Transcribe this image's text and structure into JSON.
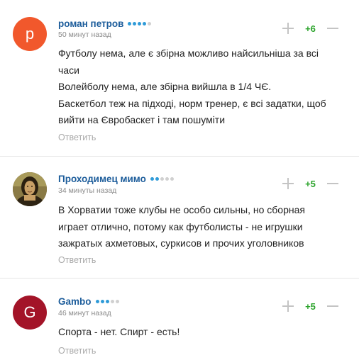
{
  "comments": [
    {
      "avatar_letter": "р",
      "avatar_color": "#f1582c",
      "author": "роман петров",
      "rank_dots": [
        "#2f9bd8",
        "#2f9bd8",
        "#2f9bd8",
        "#2f9bd8",
        "#d0d0d0"
      ],
      "time": "50 минут назад",
      "score": "+6",
      "lines": [
        "Футболу нема, але є збірна можливо найсильніша за всі",
        "часи",
        "Волейболу нема, але збірна вийшла в 1/4 ЧЄ.",
        "Баскетбол теж на підході, норм тренер, є всі задатки, щоб",
        "вийти на Євробаскет і там пошуміти"
      ],
      "reply": "Ответить"
    },
    {
      "avatar_letter": "",
      "avatar_color": "#6b5a33",
      "avatar_image": "mona-lisa-avatar",
      "author": "Проходимец мимо",
      "rank_dots": [
        "#2f9bd8",
        "#2f9bd8",
        "#d0d0d0",
        "#d0d0d0",
        "#d0d0d0"
      ],
      "time": "34 минуты назад",
      "score": "+5",
      "lines": [
        "В Хорватии тоже клубы не особо сильны, но сборная",
        "играет отлично, потому как футболисты - не игрушки",
        "зажратых ахметовых, суркисов и прочих уголовников"
      ],
      "reply": "Ответить"
    },
    {
      "avatar_letter": "G",
      "avatar_color": "#a31428",
      "author": "Gambo",
      "rank_dots": [
        "#2f9bd8",
        "#2f9bd8",
        "#2f9bd8",
        "#d0d0d0",
        "#d0d0d0"
      ],
      "time": "46 минут назад",
      "score": "+5",
      "lines": [
        "Спорта - нет. Спирт - есть!"
      ],
      "reply": "Ответить"
    }
  ]
}
